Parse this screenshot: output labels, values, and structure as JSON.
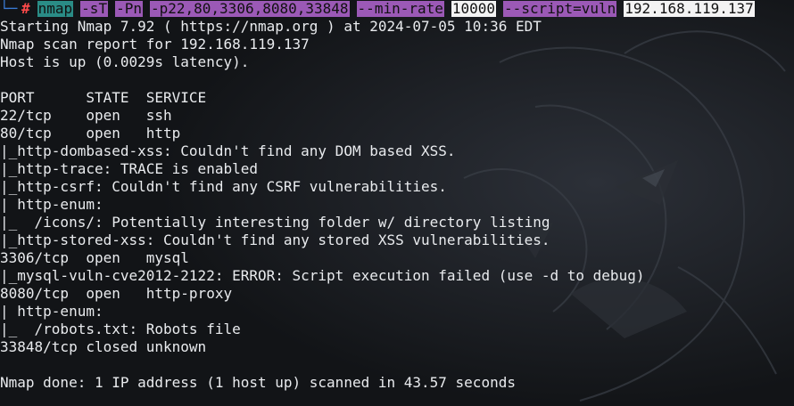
{
  "prompt": {
    "hash": "#",
    "segments": [
      {
        "type": "cmd",
        "text": "nmap"
      },
      {
        "type": "opt",
        "text": "-sT"
      },
      {
        "type": "opt",
        "text": "-Pn"
      },
      {
        "type": "opt",
        "text": "-p22,80,3306,8080,33848"
      },
      {
        "type": "opt",
        "text": "--min-rate"
      },
      {
        "type": "val",
        "text": "10000"
      },
      {
        "type": "opt",
        "text": "--script=vuln"
      },
      {
        "type": "val",
        "text": "192.168.119.137"
      }
    ]
  },
  "output": [
    "Starting Nmap 7.92 ( https://nmap.org ) at 2024-07-05 10:36 EDT",
    "Nmap scan report for 192.168.119.137",
    "Host is up (0.0029s latency).",
    "",
    "PORT      STATE  SERVICE",
    "22/tcp    open   ssh",
    "80/tcp    open   http",
    "|_http-dombased-xss: Couldn't find any DOM based XSS.",
    "|_http-trace: TRACE is enabled",
    "|_http-csrf: Couldn't find any CSRF vulnerabilities.",
    "| http-enum:",
    "|_  /icons/: Potentially interesting folder w/ directory listing",
    "|_http-stored-xss: Couldn't find any stored XSS vulnerabilities.",
    "3306/tcp  open   mysql",
    "|_mysql-vuln-cve2012-2122: ERROR: Script execution failed (use -d to debug)",
    "8080/tcp  open   http-proxy",
    "| http-enum:",
    "|_  /robots.txt: Robots file",
    "33848/tcp closed unknown",
    "",
    "Nmap done: 1 IP address (1 host up) scanned in 43.57 seconds"
  ]
}
